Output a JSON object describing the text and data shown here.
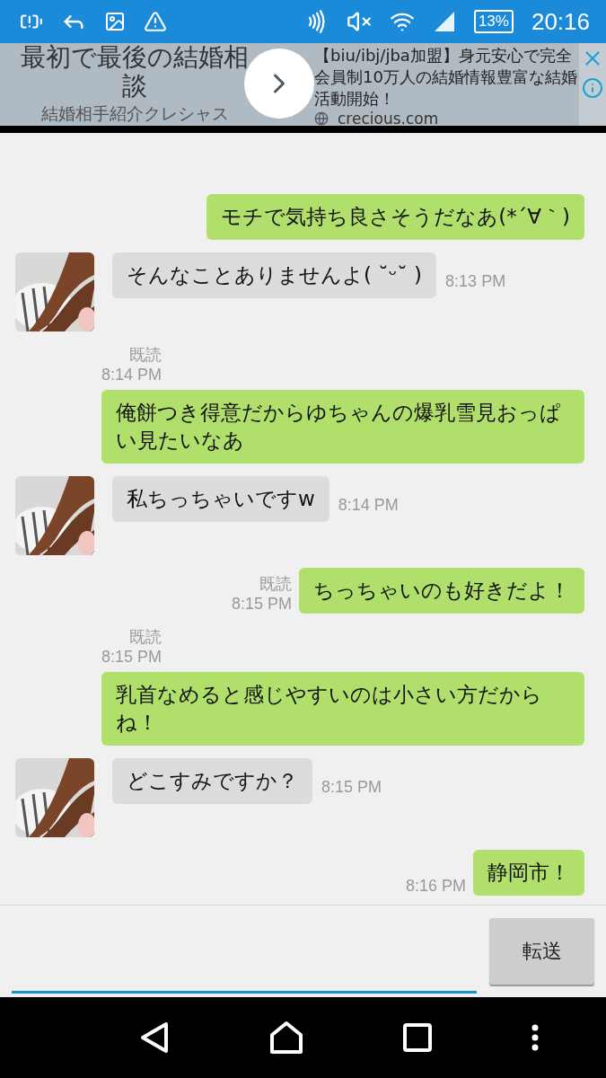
{
  "status_bar": {
    "battery_percent": "13%",
    "time": "20:16"
  },
  "ad": {
    "title": "最初で最後の結婚相談",
    "subtitle": "結婚相手紹介クレシャス",
    "body": "【biu/ibj/jba加盟】身元安心で完全会員制10万人の結婚情報豊富な結婚活動開始！",
    "domain": "crecious.com"
  },
  "messages": [
    {
      "kind": "sent",
      "text": "モチで気持ち良さそうだなあ(*´∀｀)"
    },
    {
      "kind": "received",
      "text": "そんなことありませんよ( ˘ᵕ˘ )",
      "time": "8:13 PM"
    },
    {
      "kind": "sent",
      "read": "既読",
      "time": "8:14 PM",
      "text": "俺餅つき得意だからゆちゃんの爆乳雪見おっぱい見たいなあ"
    },
    {
      "kind": "received",
      "text": "私ちっちゃいですw",
      "time": "8:14 PM"
    },
    {
      "kind": "sent",
      "read": "既読",
      "time": "8:15 PM",
      "text": "ちっちゃいのも好きだよ！"
    },
    {
      "kind": "sent",
      "read": "既読",
      "time": "8:15 PM",
      "text": "乳首なめると感じやすいのは小さい方だからね！"
    },
    {
      "kind": "received",
      "text": "どこすみですか？",
      "time": "8:15 PM"
    },
    {
      "kind": "sent",
      "time": "8:16 PM",
      "text": "静岡市！"
    }
  ],
  "composer": {
    "send_button": "転送"
  }
}
